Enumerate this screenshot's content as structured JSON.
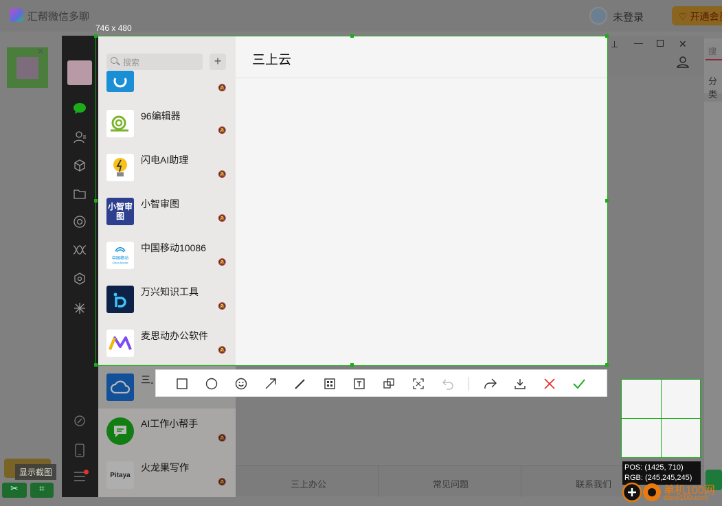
{
  "app": {
    "title": "汇帮微信多聊",
    "login_text": "未登录",
    "vip_label": "开通会员"
  },
  "capture": {
    "size_label": "746 x 480",
    "pos_text": "POS: (1425, 710)",
    "rgb_text": "RGB: (245,245,245)"
  },
  "search": {
    "placeholder": "搜索"
  },
  "conversations": [
    {
      "name": "96编辑器"
    },
    {
      "name": "闪电AI助理"
    },
    {
      "name": "小智审图"
    },
    {
      "name": "中国移动10086"
    },
    {
      "name": "万兴知识工具"
    },
    {
      "name": "麦思动办公软件"
    },
    {
      "name": "三上云"
    },
    {
      "name": "AI工作小帮手"
    },
    {
      "name": "火龙果写作"
    }
  ],
  "icon_text": {
    "xiaozhi": "小智审图",
    "pitaya": "Pitaya",
    "cmcc": "中国移动",
    "cmcc_en": "China Mobile"
  },
  "chat": {
    "title": "三上云"
  },
  "bottom_tabs": [
    "三上办公",
    "常见问题",
    "联系我们"
  ],
  "right_panel": {
    "search_placeholder": "搜索",
    "category_label": "分类"
  },
  "left_tooltip": "显示截图",
  "watermark": {
    "text": "单机100网",
    "url": "danji100.com"
  },
  "colors": {
    "accent": "#1aad19",
    "close": "#e5322d",
    "watermark": "#e87a10"
  }
}
